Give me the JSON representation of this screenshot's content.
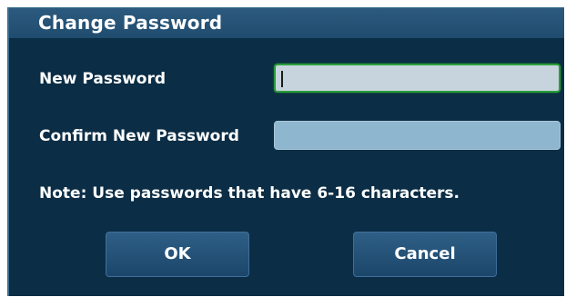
{
  "dialog": {
    "title": "Change Password",
    "new_password": {
      "label": "New Password",
      "value": ""
    },
    "confirm_password": {
      "label": "Confirm New Password",
      "value": ""
    },
    "note": "Note: Use passwords that have 6-16 characters.",
    "ok_label": "OK",
    "cancel_label": "Cancel"
  },
  "colors": {
    "background": "#0b2d45",
    "titlebar": "#1f4c6e",
    "active_border": "#2a9d3a",
    "button": "#24527a"
  }
}
